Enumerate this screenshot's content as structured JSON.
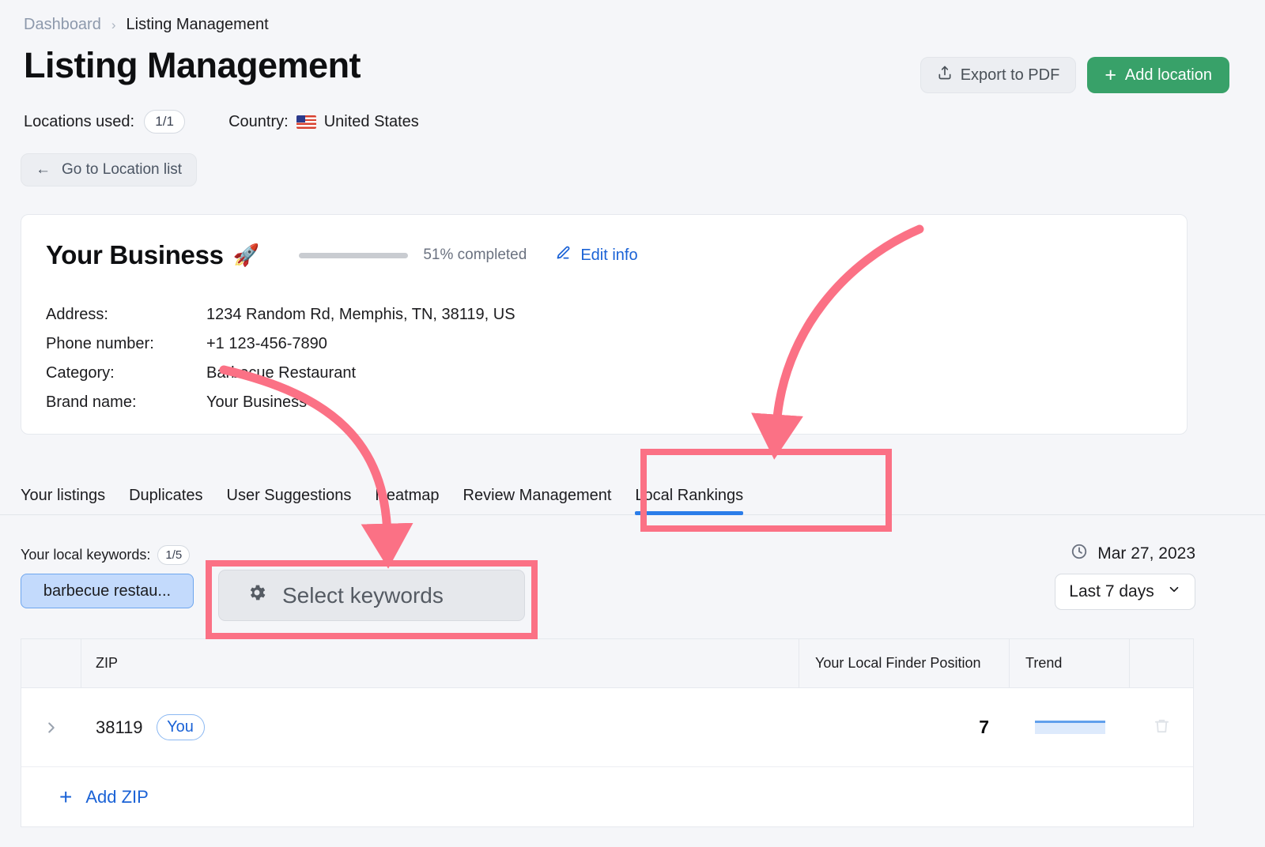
{
  "breadcrumb": {
    "parent": "Dashboard",
    "separator": "›",
    "current": "Listing Management"
  },
  "header": {
    "title": "Listing Management",
    "export_label": "Export to PDF",
    "export_icon": "upload-icon",
    "add_location_label": "Add location",
    "add_location_plus": "+"
  },
  "meta": {
    "locations_label": "Locations used:",
    "locations_value": "1/1",
    "country_label": "Country:",
    "country_value": "United States",
    "country_flag": "us-flag-icon"
  },
  "location_list_button": {
    "arrow": "←",
    "label": "Go to Location list"
  },
  "business": {
    "name": "Your Business",
    "rocket": "🚀",
    "progress_percent": 51,
    "progress_label": "51% completed",
    "progress_color": "#37996b",
    "edit_label": "Edit info",
    "edit_icon": "pencil-icon",
    "fields": [
      {
        "label": "Address:",
        "value": "1234 Random Rd, Memphis, TN, 38119, US"
      },
      {
        "label": "Phone number:",
        "value": "+1 123-456-7890"
      },
      {
        "label": "Category:",
        "value": "Barbecue Restaurant"
      },
      {
        "label": "Brand name:",
        "value": "Your Business"
      }
    ]
  },
  "tabs": [
    {
      "label": "Your listings",
      "active": false
    },
    {
      "label": "Duplicates",
      "active": false
    },
    {
      "label": "User Suggestions",
      "active": false
    },
    {
      "label": "Heatmap",
      "active": false
    },
    {
      "label": "Review Management",
      "active": false
    },
    {
      "label": "Local Rankings",
      "active": true
    }
  ],
  "keywords": {
    "label": "Your local keywords:",
    "count": "1/5",
    "chip": "barbecue restau...",
    "select_button": "Select keywords",
    "select_icon": "gear-icon"
  },
  "daterange": {
    "date": "Mar 27, 2023",
    "clock_icon": "clock-icon",
    "period": "Last 7 days",
    "chevron": "⌄"
  },
  "table": {
    "columns": [
      "ZIP",
      "Your Local Finder Position",
      "Trend"
    ],
    "rows": [
      {
        "expand": "›",
        "zip": "38119",
        "badge": "You",
        "position": "7",
        "trend_label": "flat",
        "delete_icon": "trash-icon"
      }
    ],
    "add_zip_label": "Add ZIP",
    "add_zip_plus": "+"
  },
  "annotations": {
    "highlight_color": "#fb7185",
    "boxes": [
      "Local Rankings",
      "Select keywords"
    ],
    "arrows": [
      "arrow-to-local-rankings",
      "arrow-to-select-keywords"
    ]
  }
}
